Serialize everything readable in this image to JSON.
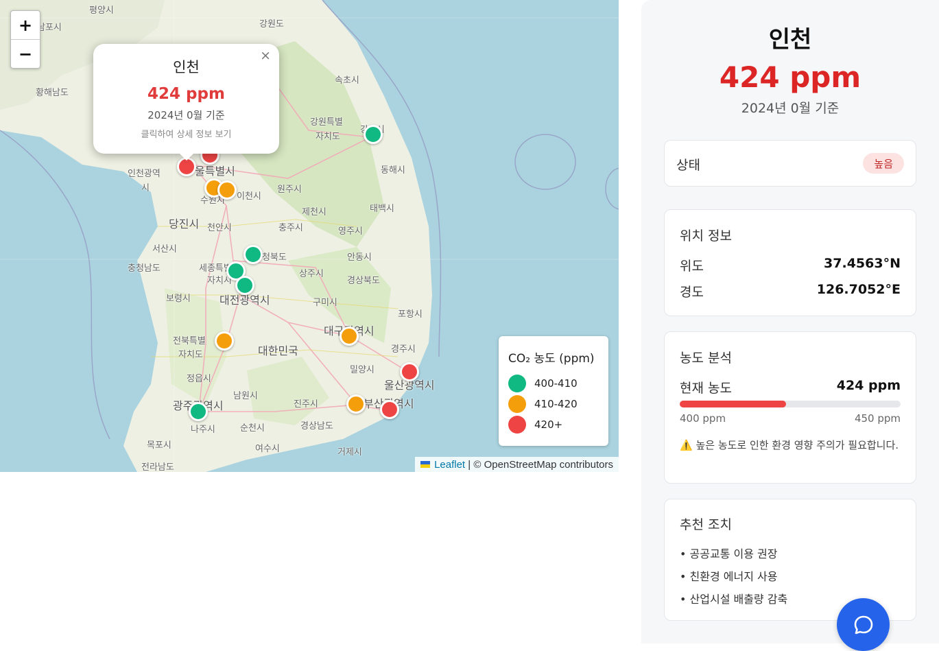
{
  "map": {
    "zoom_in_label": "+",
    "zoom_out_label": "−",
    "place_labels": [
      {
        "text": "평양시"
      },
      {
        "text": "남포시"
      },
      {
        "text": "강원도"
      },
      {
        "text": "황해남도"
      },
      {
        "text": "속초시"
      },
      {
        "text": "강원특별"
      },
      {
        "text": "자치도"
      },
      {
        "text": "강릉시"
      },
      {
        "text": "동해시"
      },
      {
        "text": "인천광역"
      },
      {
        "text": "시"
      },
      {
        "text": "울특별시"
      },
      {
        "text": "원주시"
      },
      {
        "text": "수원시"
      },
      {
        "text": "이천시"
      },
      {
        "text": "제천시"
      },
      {
        "text": "태백시"
      },
      {
        "text": "당진시"
      },
      {
        "text": "천안시"
      },
      {
        "text": "충주시"
      },
      {
        "text": "영주시"
      },
      {
        "text": "서산시"
      },
      {
        "text": "충청북도"
      },
      {
        "text": "안동시"
      },
      {
        "text": "충청남도"
      },
      {
        "text": "세종특별"
      },
      {
        "text": "자치시"
      },
      {
        "text": "상주시"
      },
      {
        "text": "경상북도"
      },
      {
        "text": "보령시"
      },
      {
        "text": "대전광역시"
      },
      {
        "text": "구미시"
      },
      {
        "text": "포항시"
      },
      {
        "text": "대구광역시"
      },
      {
        "text": "전북특별"
      },
      {
        "text": "자치도"
      },
      {
        "text": "대한민국"
      },
      {
        "text": "경주시"
      },
      {
        "text": "밀양시"
      },
      {
        "text": "울산광역시"
      },
      {
        "text": "정읍시"
      },
      {
        "text": "남원시"
      },
      {
        "text": "광주광역시"
      },
      {
        "text": "진주시"
      },
      {
        "text": "부산광역시"
      },
      {
        "text": "나주시"
      },
      {
        "text": "순천시"
      },
      {
        "text": "경상남도"
      },
      {
        "text": "목포시"
      },
      {
        "text": "여수시"
      },
      {
        "text": "거제시"
      },
      {
        "text": "전라남도"
      }
    ],
    "markers": [
      {
        "city": "인천",
        "level": "high"
      },
      {
        "city": "서울",
        "level": "high"
      },
      {
        "city": "수원",
        "level": "mid"
      },
      {
        "city": "이천",
        "level": "mid"
      },
      {
        "city": "강릉",
        "level": "low"
      },
      {
        "city": "청주",
        "level": "low"
      },
      {
        "city": "세종",
        "level": "low"
      },
      {
        "city": "대전",
        "level": "low"
      },
      {
        "city": "전주",
        "level": "mid"
      },
      {
        "city": "대구",
        "level": "mid"
      },
      {
        "city": "울산",
        "level": "high"
      },
      {
        "city": "창원",
        "level": "mid"
      },
      {
        "city": "부산",
        "level": "high"
      },
      {
        "city": "광주",
        "level": "low"
      }
    ],
    "popup": {
      "title": "인천",
      "value": "424 ppm",
      "date": "2024년 0월 기준",
      "hint": "클릭하여 상세 정보 보기",
      "close": "×"
    },
    "legend": {
      "title": "CO₂ 농도 (ppm)",
      "items": [
        {
          "label": "400-410",
          "color": "#10b981"
        },
        {
          "label": "410-420",
          "color": "#f59e0b"
        },
        {
          "label": "420+",
          "color": "#ef4444"
        }
      ]
    },
    "attribution": {
      "leaflet": "Leaflet",
      "rest": "| © OpenStreetMap contributors"
    }
  },
  "panel": {
    "city": "인천",
    "value": "424 ppm",
    "date": "2024년 0월 기준",
    "status": {
      "label": "상태",
      "badge": "높음"
    },
    "location": {
      "title": "위치 정보",
      "lat_label": "위도",
      "lat": "37.4563°N",
      "lng_label": "경도",
      "lng": "126.7052°E"
    },
    "analysis": {
      "title": "농도 분석",
      "current_label": "현재 농도",
      "current": "424 ppm",
      "bar_fraction": 0.48,
      "min": "400 ppm",
      "max": "450 ppm",
      "warning": "높은 농도로 인한 환경 영향 주의가 필요합니다."
    },
    "recommend": {
      "title": "추천 조치",
      "items": [
        "공공교통 이용 권장",
        "친환경 에너지 사용",
        "산업시설 배출량 감축"
      ]
    }
  },
  "colors": {
    "high": "#ef4444",
    "mid": "#f59e0b",
    "low": "#10b981",
    "accent": "#dc2626",
    "chat": "#2563eb"
  },
  "icons": {
    "chat": "chat-bubble-icon",
    "warning": "warning-icon",
    "flag": "ukraine-flag-icon"
  }
}
